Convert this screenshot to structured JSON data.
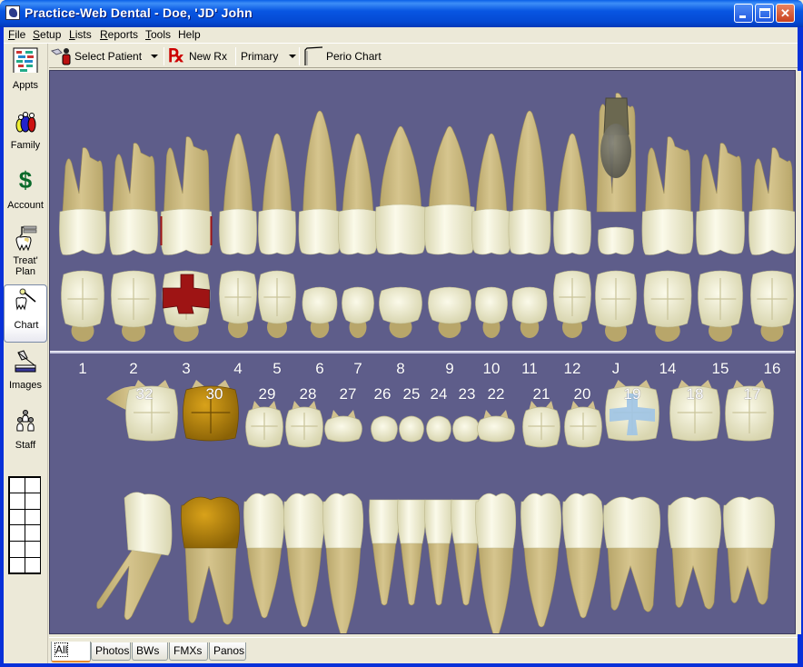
{
  "window": {
    "title": "Practice-Web Dental - Doe, 'JD' John",
    "controls": {
      "minimize": "minimize",
      "maximize": "maximize",
      "close": "close"
    }
  },
  "menu": [
    {
      "label": "File",
      "accel": "F",
      "rest": "ile"
    },
    {
      "label": "Setup",
      "accel": "S",
      "rest": "etup"
    },
    {
      "label": "Lists",
      "accel": "L",
      "rest": "ists"
    },
    {
      "label": "Reports",
      "accel": "R",
      "rest": "eports"
    },
    {
      "label": "Tools",
      "accel": "T",
      "rest": "ools"
    },
    {
      "label": "Help",
      "accel": "",
      "rest": "Help"
    }
  ],
  "sidebar": {
    "items": [
      {
        "label": "Appts",
        "icon": "calendar-icon",
        "active": false
      },
      {
        "label": "Family",
        "icon": "family-icon",
        "active": false
      },
      {
        "label": "Account",
        "icon": "dollar-icon",
        "active": false
      },
      {
        "label": "Treat'\nPlan",
        "icon": "treatment-plan-icon",
        "active": false
      },
      {
        "label": "Chart",
        "icon": "tooth-chart-icon",
        "active": true
      },
      {
        "label": "Images",
        "icon": "scanner-icon",
        "active": false
      },
      {
        "label": "Staff",
        "icon": "staff-icon",
        "active": false
      }
    ]
  },
  "toolbar": {
    "select_patient": "Select Patient",
    "new_rx": "New Rx",
    "primary": "Primary",
    "perio_chart": "Perio Chart"
  },
  "chart": {
    "background": "#5e5d8a",
    "upper_numbers": [
      "1",
      "2",
      "3",
      "4",
      "5",
      "6",
      "7",
      "8",
      "9",
      "10",
      "11",
      "12",
      "J",
      "14",
      "15",
      "16"
    ],
    "lower_numbers": [
      "32",
      "30",
      "29",
      "28",
      "27",
      "26",
      "25",
      "24",
      "23",
      "22",
      "21",
      "20",
      "19",
      "18",
      "17"
    ],
    "conditions": [
      {
        "tooth": "3",
        "type": "restoration",
        "color": "#9e1414"
      },
      {
        "tooth": "J",
        "type": "primary-tooth-with-implant",
        "color": "#6e6b58"
      },
      {
        "tooth": "30",
        "type": "crown",
        "color": "#b8860b"
      },
      {
        "tooth": "19",
        "type": "sealant",
        "color": "#9fc4e6"
      }
    ]
  },
  "tabs": [
    {
      "label": "All",
      "active": true
    },
    {
      "label": "Photos",
      "active": false
    },
    {
      "label": "BWs",
      "active": false
    },
    {
      "label": "FMXs",
      "active": false
    },
    {
      "label": "Panos",
      "active": false
    }
  ]
}
